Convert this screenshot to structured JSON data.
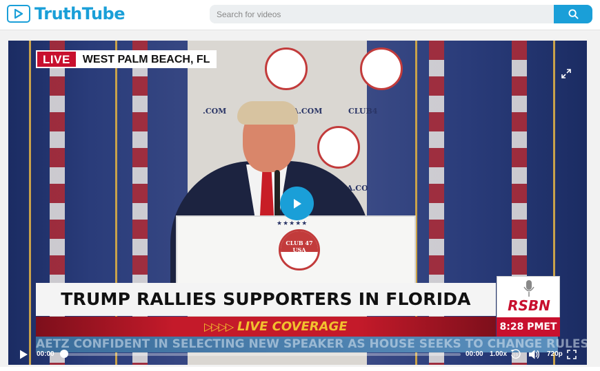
{
  "header": {
    "logo_text": "TruthTube",
    "logo_icon": "play-icon",
    "search_placeholder": "Search for videos",
    "search_icon": "search-icon"
  },
  "video": {
    "live_label": "LIVE",
    "location": "WEST PALM BEACH, FL",
    "headline": "TRUMP RALLIES SUPPORTERS IN FLORIDA",
    "banner": "LIVE COVERAGE",
    "banner_arrows": "▷▷▷▷",
    "ticker": "AETZ CONFIDENT IN SELECTING NEW SPEAKER AS HOUSE SEEKS TO CHANGE RULES    OVERSIGHT",
    "network": "RSBN",
    "network_time": "8:28 PMET",
    "backdrop_text_1": "CLUB 47 USA",
    "backdrop_text_2": "CLUB47USA.COM",
    "backdrop_text_3": "USA.COM",
    "backdrop_text_4": ".COM",
    "backdrop_text_5": "CLUB4",
    "backdrop_text_6": "SA.CO",
    "podium_stars": "★★★★★",
    "podium_logo": "CLUB 47 USA"
  },
  "controls": {
    "current_time": "00:00",
    "duration": "00:00",
    "speed": "1.00x",
    "rewind_seconds": "10",
    "quality": "720p",
    "progress": 0
  },
  "colors": {
    "brand": "#1a9fd8",
    "live_red": "#c8102e",
    "banner_text": "#f2c12e"
  }
}
